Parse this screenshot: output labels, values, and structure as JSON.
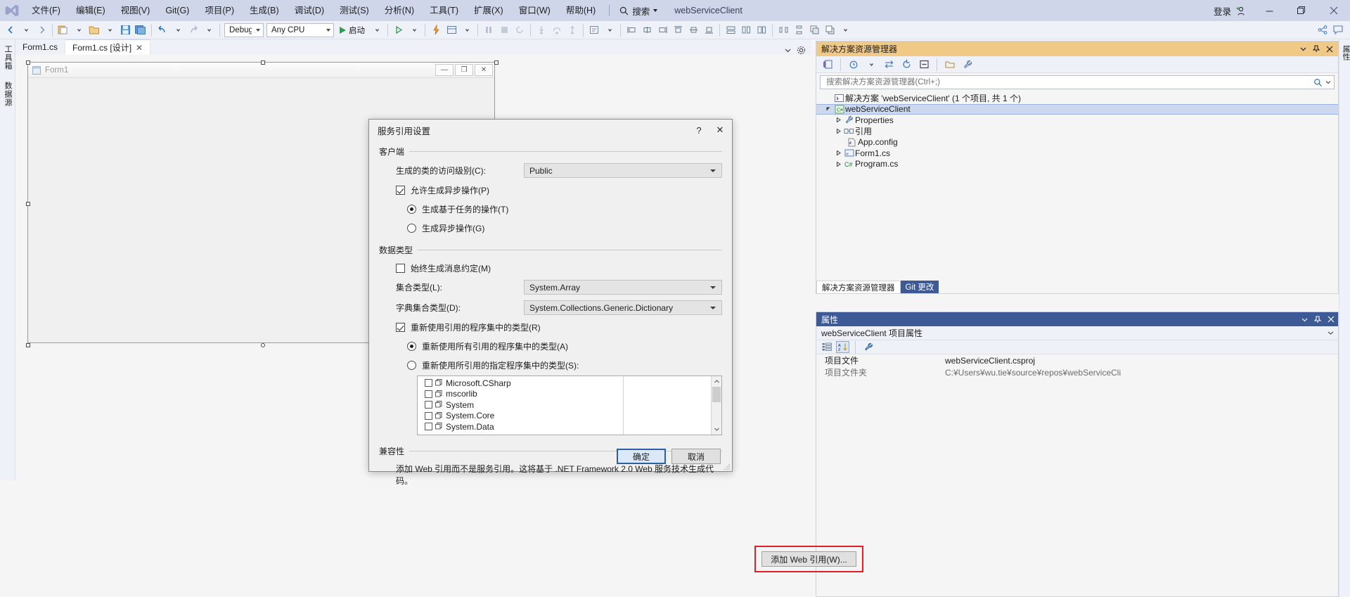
{
  "titlebar": {
    "menus": [
      "文件(F)",
      "编辑(E)",
      "视图(V)",
      "Git(G)",
      "项目(P)",
      "生成(B)",
      "调试(D)",
      "测试(S)",
      "分析(N)",
      "工具(T)",
      "扩展(X)",
      "窗口(W)",
      "帮助(H)"
    ],
    "search_label": "搜索",
    "project_name": "webServiceClient",
    "signin_label": "登录",
    "minimize": "—",
    "maximize": "❐",
    "close": "✕"
  },
  "toolbar": {
    "config_value": "Debug",
    "platform_value": "Any CPU",
    "start_label": "启动"
  },
  "left_rail": {
    "tabs": [
      "工具箱",
      "数据源"
    ]
  },
  "right_rail": {
    "tabs": [
      "属性"
    ]
  },
  "doc_tabs": [
    {
      "label": "Form1.cs",
      "active": false,
      "closable": false
    },
    {
      "label": "Form1.cs [设计]",
      "active": true,
      "closable": true
    }
  ],
  "designer": {
    "form_title": "Form1",
    "minimize": "—",
    "maximize": "❐",
    "close": "✕"
  },
  "solution_explorer": {
    "title": "解决方案资源管理器",
    "search_placeholder": "搜索解决方案资源管理器(Ctrl+;)",
    "tree": [
      {
        "label": "解决方案 'webServiceClient' (1 个项目, 共 1 个)",
        "indent": 0,
        "arrow": "",
        "icon": "solution-icon",
        "selected": false
      },
      {
        "label": "webServiceClient",
        "indent": 1,
        "arrow": "▲",
        "icon": "csharp-project-icon",
        "selected": true
      },
      {
        "label": "Properties",
        "indent": 2,
        "arrow": "▶",
        "icon": "wrench-icon",
        "selected": false
      },
      {
        "label": "引用",
        "indent": 2,
        "arrow": "▶",
        "icon": "references-icon",
        "selected": false
      },
      {
        "label": "App.config",
        "indent": 3,
        "arrow": "",
        "icon": "config-file-icon",
        "selected": false
      },
      {
        "label": "Form1.cs",
        "indent": 2,
        "arrow": "▶",
        "icon": "form-icon",
        "selected": false
      },
      {
        "label": "Program.cs",
        "indent": 2,
        "arrow": "▶",
        "icon": "csharp-file-icon",
        "selected": false
      }
    ],
    "bottom_tabs": [
      {
        "label": "解决方案资源管理器",
        "active": true
      },
      {
        "label": "Git 更改",
        "active": false
      }
    ]
  },
  "properties": {
    "title": "属性",
    "object_name": "webServiceClient 项目属性",
    "rows": [
      {
        "key": "项目文件",
        "value": "webServiceClient.csproj",
        "muted": false
      },
      {
        "key": "项目文件夹",
        "value": "C:¥Users¥wu.tie¥source¥repos¥webServiceCli",
        "muted": true
      }
    ]
  },
  "dialog": {
    "title": "服务引用设置",
    "help_label": "?",
    "close_label": "✕",
    "groups": {
      "client": {
        "title": "客户端",
        "access_label": "生成的类的访问级别(C):",
        "access_value": "Public",
        "async_checkbox": {
          "label": "允许生成异步操作(P)",
          "checked": true
        },
        "radio_task": {
          "label": "生成基于任务的操作(T)",
          "selected": true
        },
        "radio_async": {
          "label": "生成异步操作(G)",
          "selected": false
        }
      },
      "datatype": {
        "title": "数据类型",
        "msgcontract_checkbox": {
          "label": "始终生成消息约定(M)",
          "checked": false
        },
        "collection_label": "集合类型(L):",
        "collection_value": "System.Array",
        "dictionary_label": "字典集合类型(D):",
        "dictionary_value": "System.Collections.Generic.Dictionary",
        "reuse_checkbox": {
          "label": "重新使用引用的程序集中的类型(R)",
          "checked": true
        },
        "radio_all": {
          "label": "重新使用所有引用的程序集中的类型(A)",
          "selected": true
        },
        "radio_specified": {
          "label": "重新使用所引用的指定程序集中的类型(S):",
          "selected": false
        },
        "assemblies": [
          "Microsoft.CSharp",
          "mscorlib",
          "System",
          "System.Core",
          "System.Data"
        ]
      },
      "compatibility": {
        "title": "兼容性",
        "description": "添加 Web 引用而不是服务引用。这将基于 .NET Framework 2.0 Web 服务技术生成代码。",
        "add_web_reference_button": "添加 Web 引用(W)..."
      }
    },
    "ok_label": "确定",
    "cancel_label": "取消"
  },
  "colors": {
    "titlebar_bg": "#cfd6ea",
    "se_header": "#f0c987",
    "props_header": "#3d5a96",
    "selection": "#cbd8ef",
    "highlight_red": "#e31e24",
    "accent_blue": "#2c5fa8"
  }
}
